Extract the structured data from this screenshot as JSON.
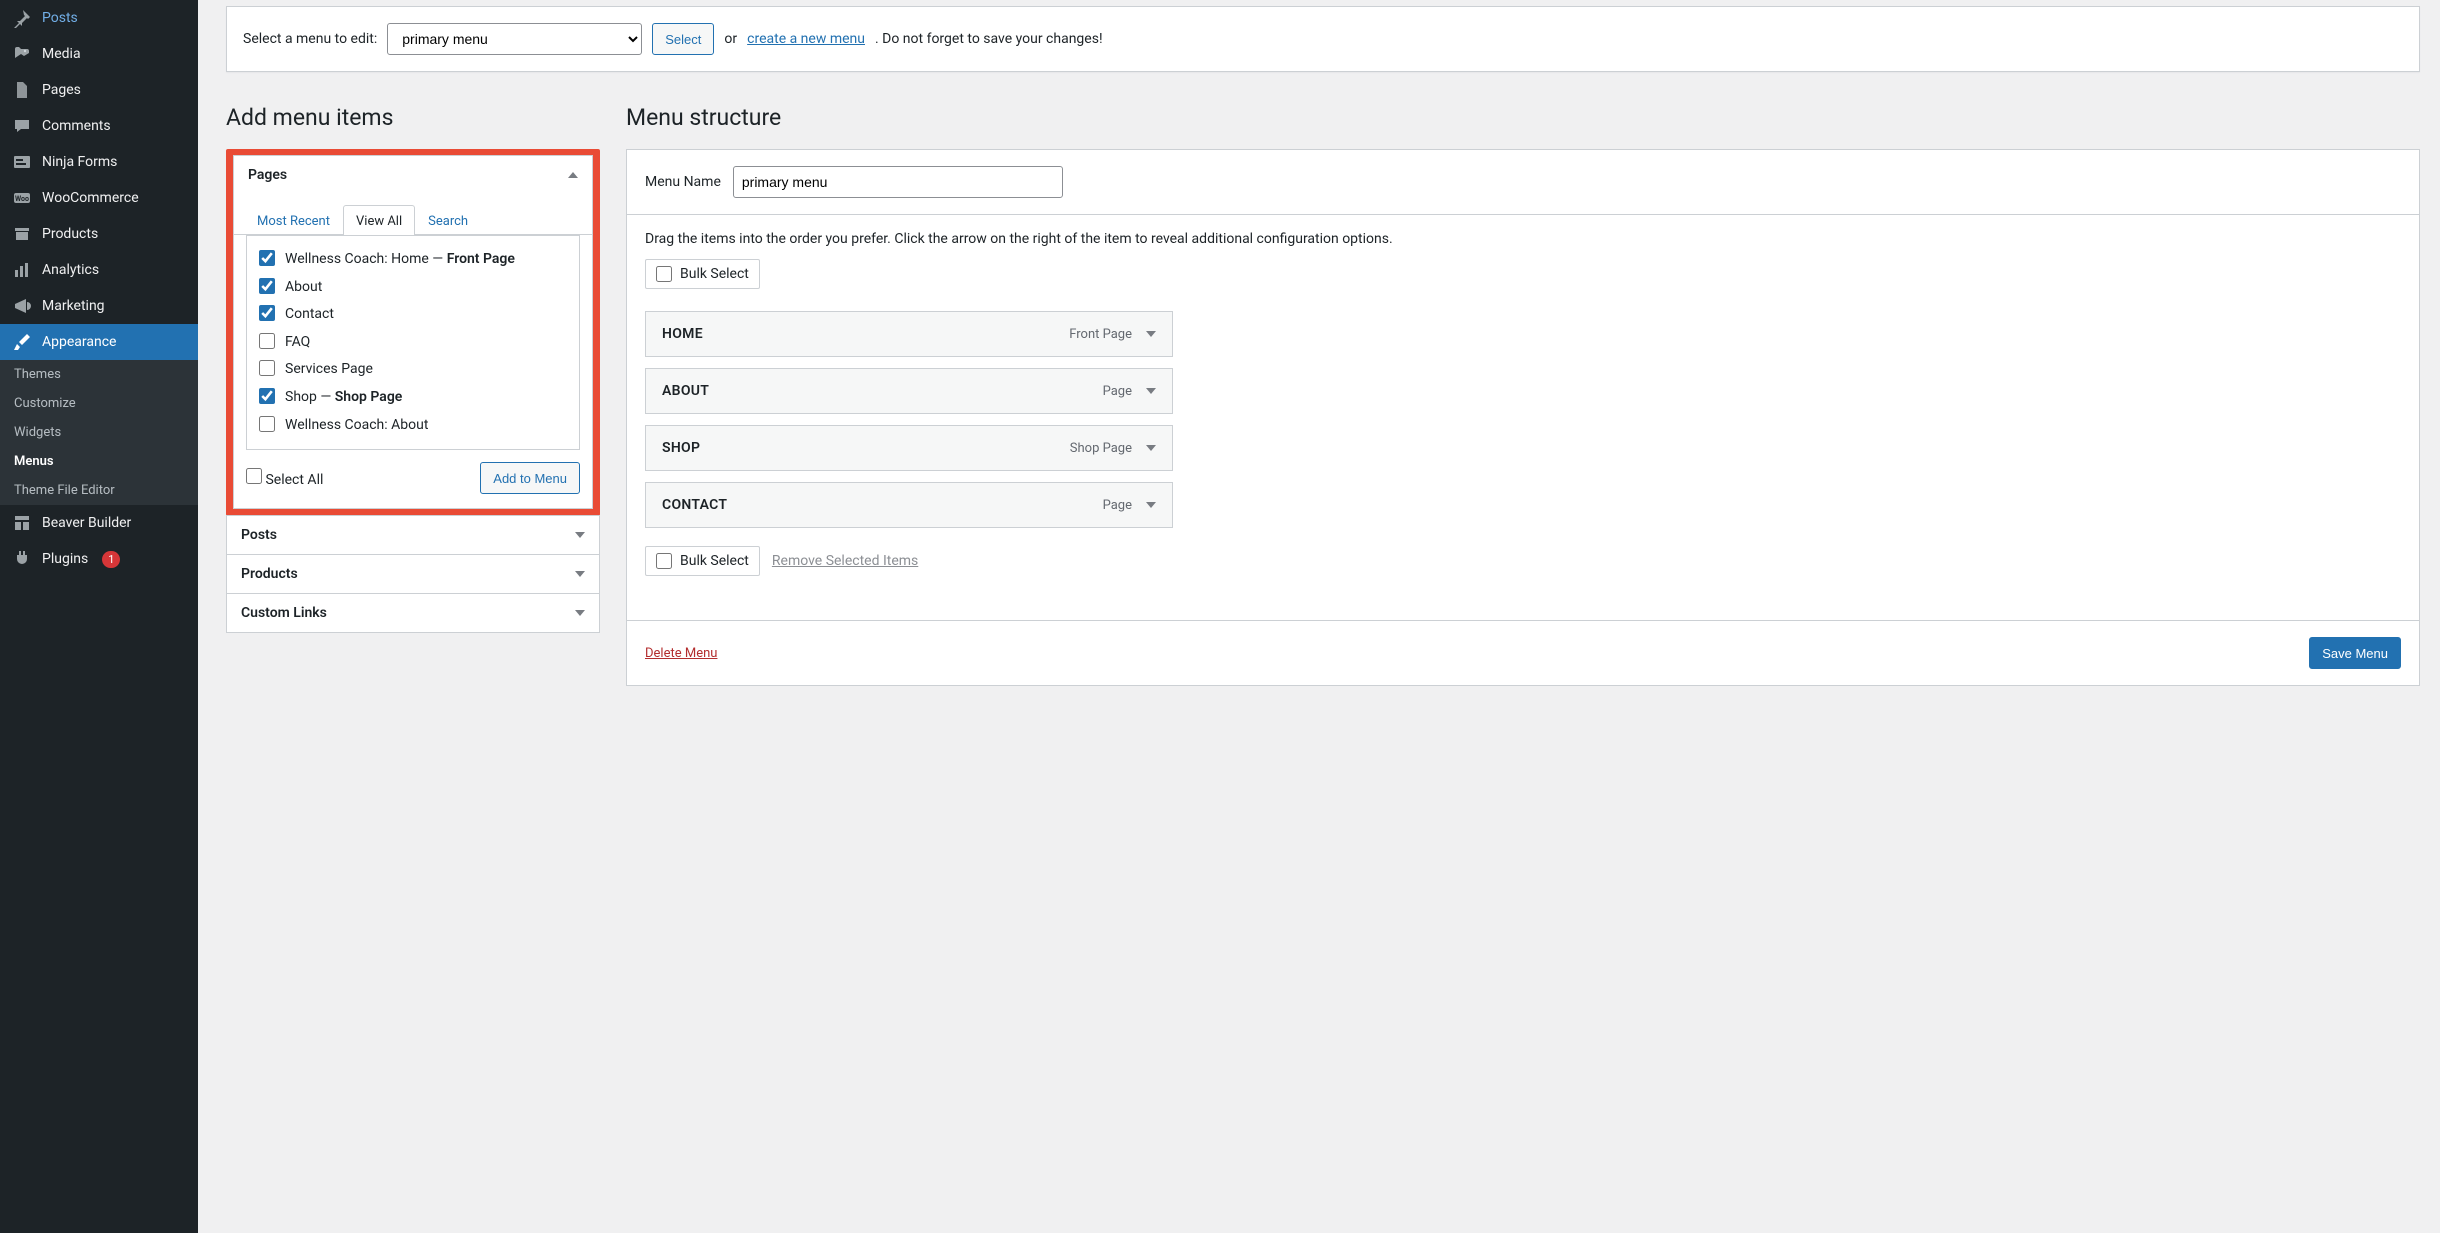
{
  "sidebar": {
    "items": [
      {
        "label": "Posts"
      },
      {
        "label": "Media"
      },
      {
        "label": "Pages"
      },
      {
        "label": "Comments"
      },
      {
        "label": "Ninja Forms"
      },
      {
        "label": "WooCommerce"
      },
      {
        "label": "Products"
      },
      {
        "label": "Analytics"
      },
      {
        "label": "Marketing"
      },
      {
        "label": "Appearance"
      },
      {
        "label": "Beaver Builder"
      },
      {
        "label": "Plugins"
      }
    ],
    "appearance_sub": [
      {
        "label": "Themes"
      },
      {
        "label": "Customize"
      },
      {
        "label": "Widgets"
      },
      {
        "label": "Menus"
      },
      {
        "label": "Theme File Editor"
      }
    ],
    "plugin_badge": "1"
  },
  "topbar": {
    "prompt": "Select a menu to edit:",
    "selected_option": "primary menu",
    "select_btn": "Select",
    "or": "or",
    "create_link": "create a new menu",
    "reminder": ". Do not forget to save your changes!"
  },
  "left": {
    "heading": "Add menu items",
    "tabs": {
      "recent": "Most Recent",
      "all": "View All",
      "search": "Search"
    },
    "accordions": {
      "pages": "Pages",
      "posts": "Posts",
      "products": "Products",
      "custom_links": "Custom Links"
    },
    "page_items": [
      {
        "label": "Wellness Coach: Home",
        "suffix": " — ",
        "extra": "Front Page",
        "checked": true
      },
      {
        "label": "About",
        "checked": true
      },
      {
        "label": "Contact",
        "checked": true
      },
      {
        "label": "FAQ",
        "checked": false
      },
      {
        "label": "Services Page",
        "checked": false
      },
      {
        "label": "Shop",
        "suffix": " — ",
        "extra": "Shop Page",
        "checked": true
      },
      {
        "label": "Wellness Coach: About",
        "checked": false
      }
    ],
    "select_all": "Select All",
    "add_btn": "Add to Menu"
  },
  "right": {
    "heading": "Menu structure",
    "name_label": "Menu Name",
    "name_value": "primary menu",
    "instructions": "Drag the items into the order you prefer. Click the arrow on the right of the item to reveal additional configuration options.",
    "bulk_select": "Bulk Select",
    "remove_selected": "Remove Selected Items",
    "menu_items": [
      {
        "title": "HOME",
        "type": "Front Page"
      },
      {
        "title": "ABOUT",
        "type": "Page"
      },
      {
        "title": "SHOP",
        "type": "Shop Page"
      },
      {
        "title": "CONTACT",
        "type": "Page"
      }
    ],
    "delete": "Delete Menu",
    "save": "Save Menu"
  }
}
